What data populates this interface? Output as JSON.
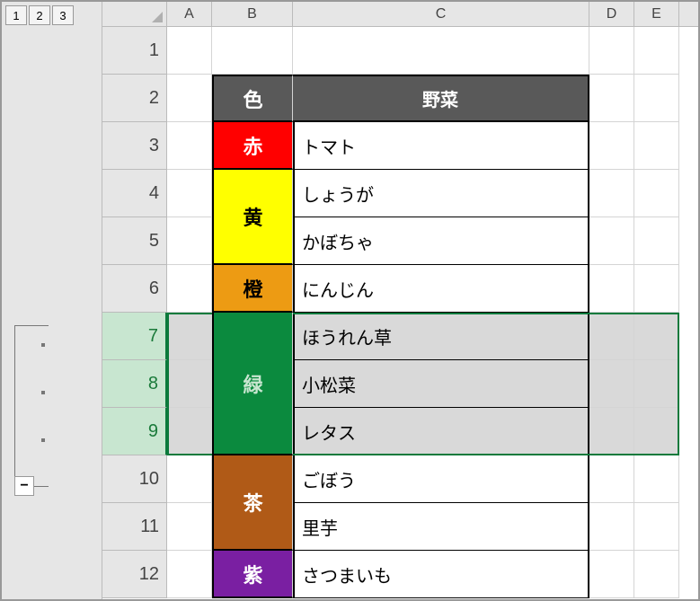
{
  "outline": {
    "levels": [
      "1",
      "2",
      "3"
    ],
    "collapse": "−"
  },
  "columns": [
    "A",
    "B",
    "C",
    "D",
    "E"
  ],
  "rowNumbers": [
    "1",
    "2",
    "3",
    "4",
    "5",
    "6",
    "7",
    "8",
    "9",
    "10",
    "11",
    "12"
  ],
  "header": {
    "color": "色",
    "veg": "野菜"
  },
  "groups": [
    {
      "label": "赤",
      "bg": "#ff0000",
      "fg": "#ffffff",
      "span": 1,
      "items": [
        "トマト"
      ]
    },
    {
      "label": "黄",
      "bg": "#ffff00",
      "fg": "#000000",
      "span": 2,
      "items": [
        "しょうが",
        "かぼちゃ"
      ]
    },
    {
      "label": "橙",
      "bg": "#ed9b13",
      "fg": "#000000",
      "span": 1,
      "items": [
        "にんじん"
      ]
    },
    {
      "label": "緑",
      "bg": "#0b8a3e",
      "fg": "#c8e6d0",
      "span": 3,
      "items": [
        "ほうれん草",
        "小松菜",
        "レタス"
      ]
    },
    {
      "label": "茶",
      "bg": "#b05a17",
      "fg": "#ffffff",
      "span": 2,
      "items": [
        "ごぼう",
        "里芋"
      ]
    },
    {
      "label": "紫",
      "bg": "#7a1fa2",
      "fg": "#ffffff",
      "span": 1,
      "items": [
        "さつまいも"
      ]
    }
  ],
  "selectedRows": [
    7,
    8,
    9
  ]
}
